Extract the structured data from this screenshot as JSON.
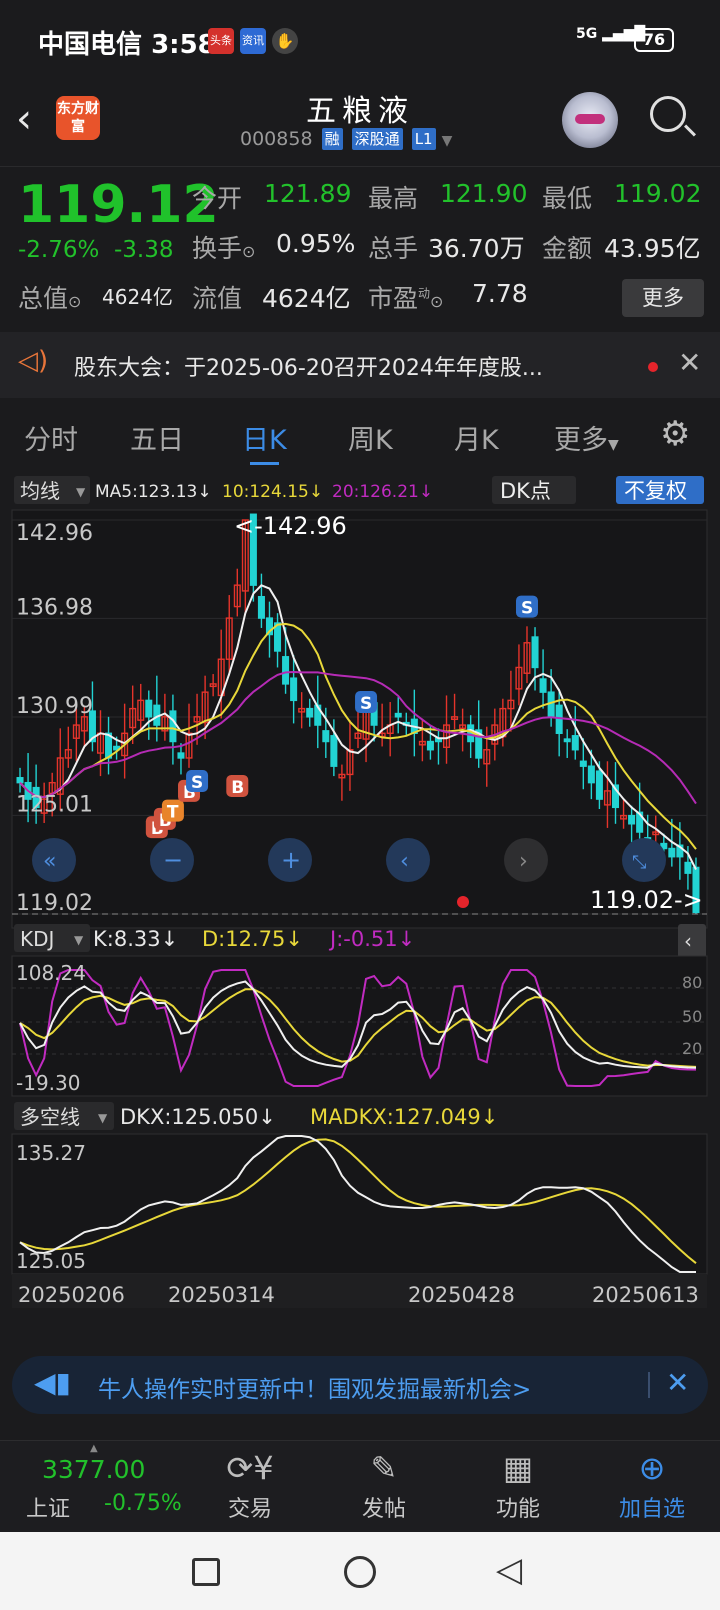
{
  "status_bar": {
    "carrier": "中国电信",
    "time": "3:58",
    "badges": [
      "头条",
      "资讯"
    ],
    "network": "5G",
    "battery": "76"
  },
  "header": {
    "logo": "东方财富",
    "title": "五粮液",
    "code": "000858",
    "tags": [
      "融",
      "深股通",
      "L1"
    ]
  },
  "quote": {
    "price": "119.12",
    "change_pct": "-2.76%",
    "change": "-3.38",
    "rows": [
      {
        "label": "今开",
        "value": "121.89"
      },
      {
        "label": "最高",
        "value": "121.90"
      },
      {
        "label": "最低",
        "value": "119.02"
      },
      {
        "label": "换手",
        "value": "0.95%"
      },
      {
        "label": "总手",
        "value": "36.70万"
      },
      {
        "label": "金额",
        "value": "43.95亿"
      },
      {
        "label": "总值",
        "value": "4624亿"
      },
      {
        "label": "流值",
        "value": "4624亿"
      },
      {
        "label": "市盈",
        "value": "7.78",
        "sup": "动"
      }
    ],
    "more_label": "更多"
  },
  "notice": {
    "text": "股东大会：于2025-06-20召开2024年年度股..."
  },
  "tabs": [
    "分时",
    "五日",
    "日K",
    "周K",
    "月K",
    "更多"
  ],
  "active_tab": "日K",
  "chart_data": {
    "type": "candlestick",
    "indicator_label": "均线",
    "ma": {
      "MA5": "MA5:123.13↓",
      "MA10": "10:124.15↓",
      "MA20": "20:126.21↓"
    },
    "dk_label": "DK点",
    "adjust_label": "不复权",
    "y_ticks": [
      "142.96",
      "136.98",
      "130.99",
      "125.01",
      "119.02"
    ],
    "high_marker": "<-142.96",
    "low_marker": "119.02->",
    "signals": [
      "B",
      "B",
      "T",
      "B",
      "S",
      "B",
      "S",
      "S"
    ],
    "kdj": {
      "name": "KDJ",
      "K": "K:8.33↓",
      "D": "D:12.75↓",
      "J": "J:-0.51↓",
      "top": "108.24",
      "bottom": "-19.30",
      "levels": [
        "80",
        "50",
        "20"
      ]
    },
    "dkx": {
      "name": "多空线",
      "DKX": "DKX:125.050↓",
      "MADKX": "MADKX:127.049↓",
      "top": "135.27",
      "bottom": "125.05"
    },
    "x_dates": [
      "20250206",
      "20250314",
      "20250428",
      "20250613"
    ],
    "close_series": [
      127,
      126,
      125.5,
      126,
      127,
      128.5,
      129,
      130.5,
      131,
      129.5,
      130,
      128.5,
      129,
      130,
      131.5,
      132,
      131,
      130.5,
      131,
      129.5,
      128.5,
      130,
      131,
      132.5,
      133,
      134.5,
      137,
      139,
      142.96,
      139,
      137,
      136,
      135,
      133,
      132,
      131.5,
      131,
      130.5,
      129.5,
      128,
      127.5,
      129,
      130,
      131.5,
      130.5,
      130,
      130.5,
      131,
      130.5,
      130,
      129.5,
      129,
      129.5,
      130.5,
      131,
      130.5,
      129.5,
      128.5,
      129,
      130.5,
      131.5,
      132,
      134,
      135.5,
      134,
      132.5,
      131,
      130,
      129.5,
      129,
      128,
      127,
      126,
      126.5,
      125.5,
      125,
      124.5,
      124,
      123.5,
      124,
      123,
      122.5,
      122.5,
      121.5,
      119.12
    ]
  },
  "banner": {
    "text": "牛人操作实时更新中！围观发掘最新机会>"
  },
  "bottom_nav": {
    "index_value": "3377.00",
    "index_name": "上证",
    "index_change": "-0.75%",
    "items": [
      "交易",
      "发帖",
      "功能",
      "加自选"
    ]
  }
}
